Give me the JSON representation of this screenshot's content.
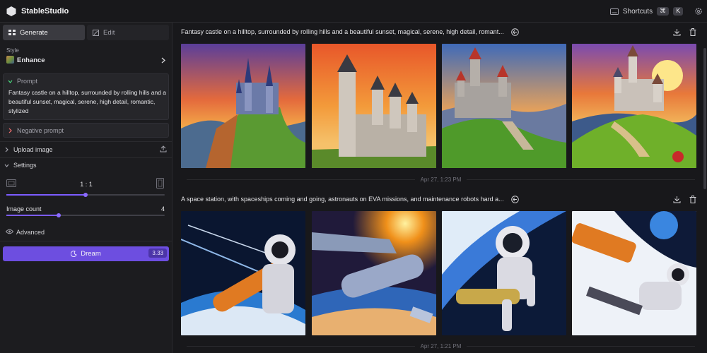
{
  "app": {
    "name": "StableStudio"
  },
  "topbar": {
    "shortcuts_label": "Shortcuts",
    "key_cmd": "⌘",
    "key_k": "K",
    "keyboard_icon": "keyboard-icon",
    "settings_icon": "gear-icon"
  },
  "sidebar": {
    "tabs": [
      {
        "label": "Generate",
        "active": true
      },
      {
        "label": "Edit",
        "active": false
      }
    ],
    "style": {
      "label": "Style",
      "value": "Enhance"
    },
    "prompt": {
      "label": "Prompt",
      "text": "Fantasy castle on a hilltop, surrounded by rolling hills and a beautiful sunset, magical, serene, high detail, romantic, stylized"
    },
    "negative_prompt": {
      "label": "Negative prompt"
    },
    "upload_image": {
      "label": "Upload image"
    },
    "settings": {
      "label": "Settings",
      "aspect_ratio": "1 : 1",
      "aspect_slider": 0.5,
      "image_count_label": "Image count",
      "image_count": "4",
      "image_count_slider": 0.33,
      "advanced_label": "Advanced"
    },
    "dream": {
      "label": "Dream",
      "cost": "3.33"
    }
  },
  "generations": [
    {
      "prompt": "Fantasy castle on a hilltop, surrounded by rolling hills and a beautiful sunset, magical, serene, high detail, romant...",
      "timestamp": "Apr 27, 1:23 PM"
    },
    {
      "prompt": "A space station, with spaceships coming and going, astronauts on EVA missions, and maintenance robots hard a...",
      "timestamp": "Apr 27, 1:21 PM"
    }
  ],
  "colors": {
    "accent": "#6d4ee0",
    "background": "#18181b",
    "panel": "#1c1c1f"
  }
}
